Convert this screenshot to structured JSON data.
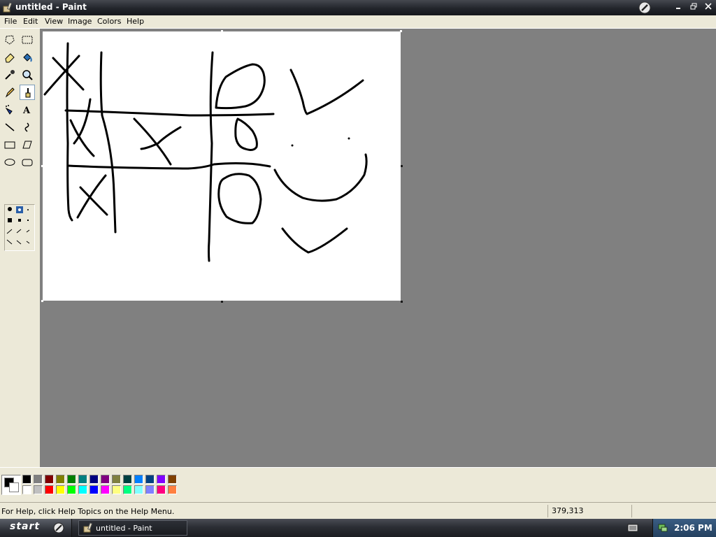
{
  "window": {
    "title": "untitled - Paint"
  },
  "menu": {
    "items": [
      "File",
      "Edit",
      "View",
      "Image",
      "Colors",
      "Help"
    ]
  },
  "tools": [
    "free-select",
    "rectangle-select",
    "eraser",
    "fill",
    "pick-color",
    "magnifier",
    "pencil",
    "brush",
    "airbrush",
    "text",
    "line",
    "curve",
    "rectangle",
    "polygon",
    "ellipse",
    "rounded-rectangle"
  ],
  "selected_tool": "brush",
  "palette": {
    "foreground": "#000000",
    "background": "#ffffff",
    "row1": [
      "#000000",
      "#808080",
      "#800000",
      "#808000",
      "#008000",
      "#008080",
      "#000080",
      "#800080",
      "#808040",
      "#004040",
      "#0080ff",
      "#004080",
      "#8000ff",
      "#804000"
    ],
    "row2": [
      "#ffffff",
      "#c0c0c0",
      "#ff0000",
      "#ffff00",
      "#00ff00",
      "#00ffff",
      "#0000ff",
      "#ff00ff",
      "#ffff80",
      "#00ff80",
      "#80ffff",
      "#8080ff",
      "#ff0080",
      "#ff8040"
    ]
  },
  "status": {
    "help_text": "For Help, click Help Topics on the Help Menu.",
    "coords": "379,313"
  },
  "taskbar": {
    "start_label": "start",
    "task_item": "untitled - Paint",
    "clock": "2:06 PM"
  }
}
